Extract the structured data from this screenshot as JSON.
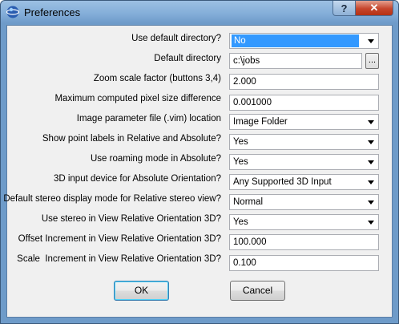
{
  "window": {
    "title": "Preferences",
    "help_label": "?",
    "close_label": "✕"
  },
  "fields": [
    {
      "label": "Use default directory?",
      "type": "combo",
      "value": "No",
      "selected": true
    },
    {
      "label": "Default directory",
      "type": "text-browse",
      "value": "c:\\jobs",
      "browse_label": "..."
    },
    {
      "label": "Zoom scale factor (buttons 3,4)",
      "type": "text",
      "value": "2.000"
    },
    {
      "label": "Maximum computed pixel size difference",
      "type": "text",
      "value": "0.001000"
    },
    {
      "label": "Image parameter file (.vim) location",
      "type": "combo",
      "value": "Image Folder"
    },
    {
      "label": "Show point labels in Relative and Absolute?",
      "type": "combo",
      "value": "Yes"
    },
    {
      "label": "Use roaming mode in Absolute?",
      "type": "combo",
      "value": "Yes"
    },
    {
      "label": "3D input device for Absolute Orientation?",
      "type": "combo",
      "value": "Any Supported 3D Input"
    },
    {
      "label": "Default stereo display mode for Relative stereo view?",
      "type": "combo",
      "value": "Normal"
    },
    {
      "label": "Use stereo in View Relative Orientation 3D?",
      "type": "combo",
      "value": "Yes"
    },
    {
      "label": "Offset Increment in View Relative Orientation 3D?",
      "type": "text",
      "value": "100.000"
    },
    {
      "label": "Scale  Increment in View Relative Orientation 3D?",
      "type": "text",
      "value": "0.100"
    }
  ],
  "buttons": {
    "ok": "OK",
    "cancel": "Cancel"
  }
}
